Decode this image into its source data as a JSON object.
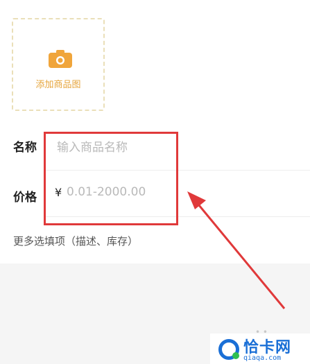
{
  "upload": {
    "icon": "camera-icon",
    "label": "添加商品图"
  },
  "form": {
    "name_label": "名称",
    "name_placeholder": "输入商品名称",
    "price_label": "价格",
    "currency_symbol": "¥",
    "price_placeholder": "0.01-2000.00",
    "more_options": "更多选填项（描述、库存）"
  },
  "watermark": {
    "title": "恰卡网",
    "domain": "qiaqa.com"
  },
  "colors": {
    "accent": "#e6a43a",
    "annotation": "#e0393a",
    "brand": "#1a6fd6"
  }
}
